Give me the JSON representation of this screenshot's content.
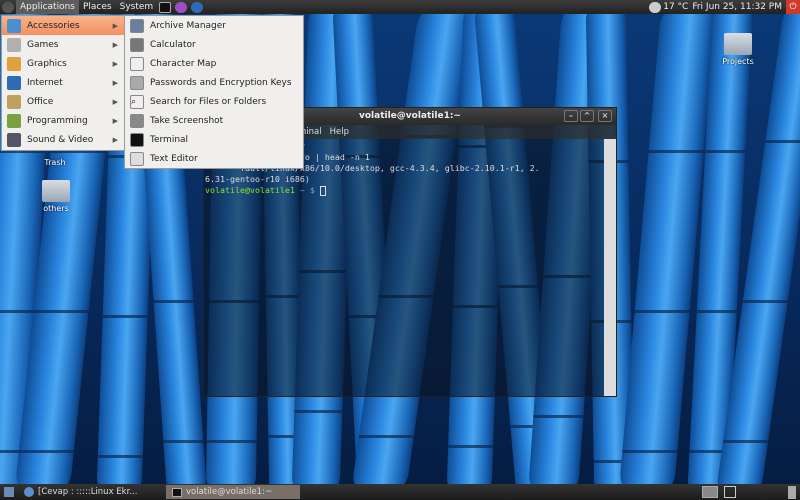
{
  "top_panel": {
    "menus": [
      "Applications",
      "Places",
      "System"
    ],
    "weather": "17 °C",
    "clock": "Fri Jun 25, 11:32 PM"
  },
  "applications_menu": [
    {
      "label": "Accessories",
      "icon": "accessories-icon"
    },
    {
      "label": "Games",
      "icon": "games-icon"
    },
    {
      "label": "Graphics",
      "icon": "graphics-icon"
    },
    {
      "label": "Internet",
      "icon": "globe-icon"
    },
    {
      "label": "Office",
      "icon": "office-icon"
    },
    {
      "label": "Programming",
      "icon": "programming-icon"
    },
    {
      "label": "Sound & Video",
      "icon": "multimedia-icon"
    }
  ],
  "accessories_menu": [
    {
      "label": "Archive Manager",
      "icon": "archive-icon"
    },
    {
      "label": "Calculator",
      "icon": "calculator-icon"
    },
    {
      "label": "Character Map",
      "icon": "character-map-icon"
    },
    {
      "label": "Passwords and Encryption Keys",
      "icon": "keys-icon"
    },
    {
      "label": "Search for Files or Folders",
      "icon": "search-icon"
    },
    {
      "label": "Take Screenshot",
      "icon": "camera-icon"
    },
    {
      "label": "Terminal",
      "icon": "terminal-icon"
    },
    {
      "label": "Text Editor",
      "icon": "text-editor-icon"
    }
  ],
  "desktop_icons": {
    "trash": "Trash",
    "others": "others",
    "projects": "Projects"
  },
  "terminal": {
    "title": "volatile@volatile1:~",
    "menus": [
      "minal",
      "Help"
    ],
    "lines": [
      "      $ gconf-editor",
      "      $ emerge --info | head -n 1",
      "       fault/linux/x86/10.0/desktop, gcc-4.3.4, glibc-2.10.1-r1, 2.",
      "6.31-gentoo-r10 i686)"
    ],
    "prompt_user": "volatile@volatile1",
    "prompt_rest": " ~ $ "
  },
  "taskbar": {
    "tasks": [
      "[Cevap : :::::Linux Ekr...",
      "volatile@volatile1:~"
    ]
  },
  "colors": {
    "menu_highlight": "#f39060",
    "prompt": "#8ae234"
  }
}
